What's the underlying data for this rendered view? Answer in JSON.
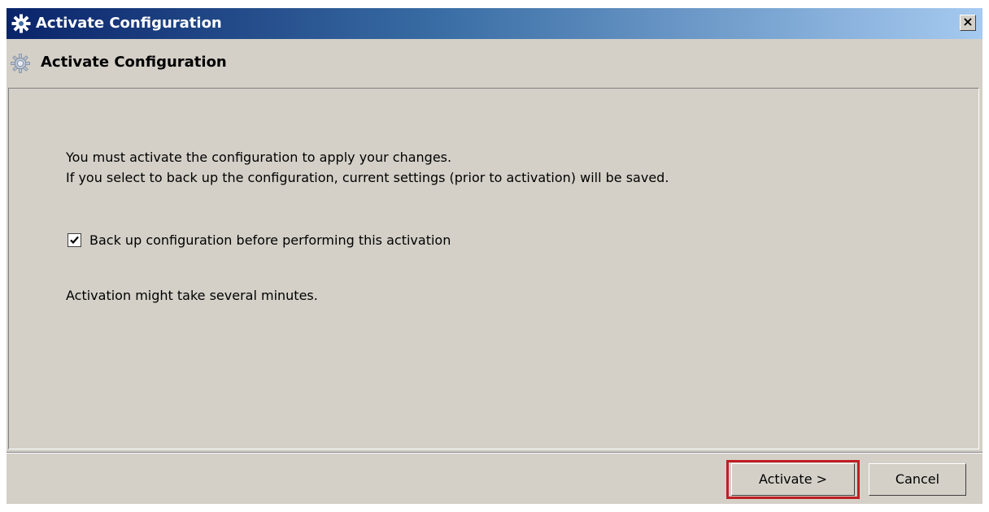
{
  "window": {
    "title": "Activate Configuration",
    "close_glyph": "×"
  },
  "header": {
    "title": "Activate Configuration",
    "icon": "gear-icon"
  },
  "content": {
    "message_line_1": "You must activate the configuration to apply your changes.",
    "message_line_2": "If you select to back up the configuration, current settings (prior to activation) will be saved.",
    "backup_checkbox": {
      "label": "Back up configuration before performing this activation",
      "checked": true
    },
    "note": "Activation might take several minutes."
  },
  "footer": {
    "activate_label": "Activate >",
    "cancel_label": "Cancel"
  },
  "colors": {
    "title_gradient_start": "#0a246a",
    "title_gradient_end": "#a6caf0",
    "dialog_background": "#d4d0c8",
    "highlight_border": "#c01e24"
  }
}
